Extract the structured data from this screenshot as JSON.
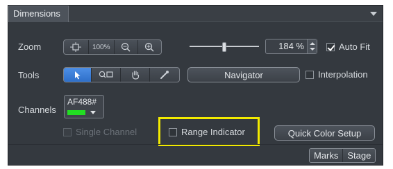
{
  "tabs": {
    "dimensions_label": "Dimensions"
  },
  "rows": {
    "zoom_label": "Zoom",
    "tools_label": "Tools",
    "channels_label": "Channels"
  },
  "zoom": {
    "buttons": [
      {
        "icon": "fit-to-window-icon"
      },
      {
        "label": "100%"
      },
      {
        "icon": "zoom-out-icon"
      },
      {
        "icon": "zoom-in-icon"
      }
    ],
    "slider_fraction": 0.5,
    "value": "184 %",
    "auto_fit_label": "Auto Fit",
    "auto_fit_checked": true
  },
  "tools": {
    "buttons": [
      {
        "icon": "pointer-arrow-icon",
        "active": true
      },
      {
        "icon": "zoom-region-icon",
        "active": false
      },
      {
        "icon": "hand-pan-icon",
        "active": false
      },
      {
        "icon": "pipette-icon",
        "active": false
      }
    ],
    "navigator_label": "Navigator",
    "interpolation_label": "Interpolation",
    "interpolation_checked": false
  },
  "channels": {
    "items": [
      {
        "name": "AF488#",
        "color": "#22dd22"
      }
    ]
  },
  "options": {
    "single_channel_label": "Single Channel",
    "single_channel_enabled": false,
    "range_indicator_label": "Range Indicator",
    "range_indicator_checked": false,
    "quick_color_setup_label": "Quick Color Setup"
  },
  "footer": {
    "marks_label": "Marks",
    "stage_label": "Stage"
  },
  "colors": {
    "panel_bg": "#34393f",
    "active_blue": "#3a7ed8",
    "highlight": "#f2ea00",
    "channel_green": "#22dd22"
  }
}
